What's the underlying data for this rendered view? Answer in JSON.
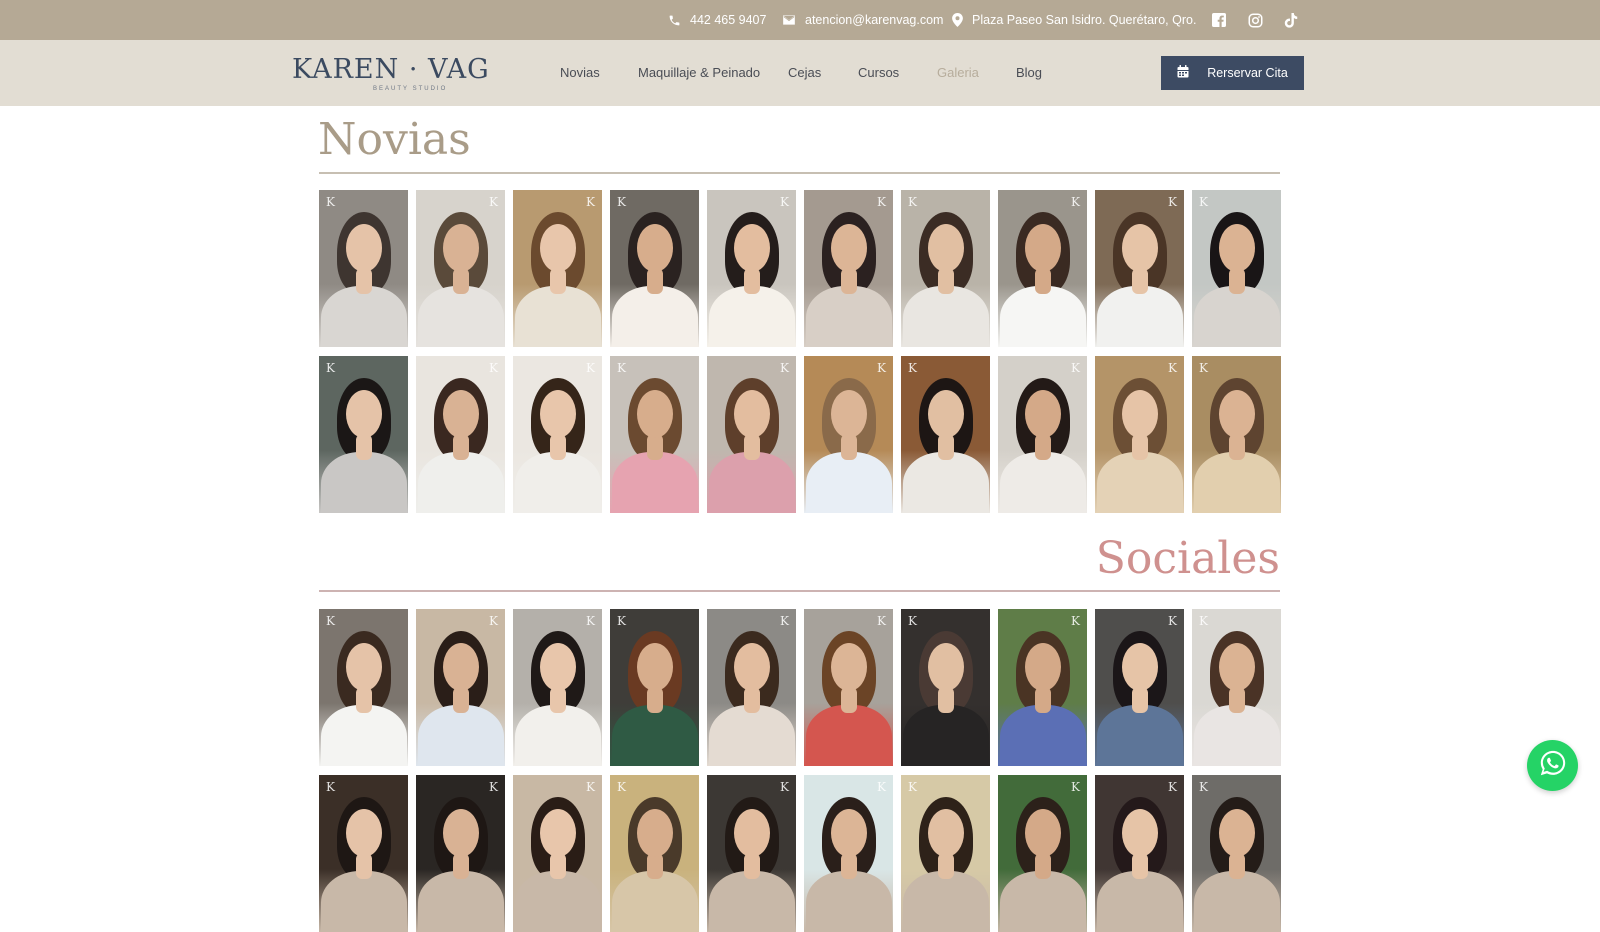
{
  "topbar": {
    "phone": "442 465 9407",
    "email": "atencion@karenvag.com",
    "address": "Plaza Paseo San Isidro. Querétaro, Qro."
  },
  "header": {
    "logo_text": "KAREN · VAG",
    "logo_subtitle": "BEAUTY STUDIO",
    "nav": [
      {
        "label": "Novias"
      },
      {
        "label": "Maquillaje & Peinado"
      },
      {
        "label": "Cejas"
      },
      {
        "label": "Cursos"
      },
      {
        "label": "Galeria"
      },
      {
        "label": "Blog"
      }
    ],
    "active_nav": "Galeria",
    "cta_label": "Rerservar Cita"
  },
  "sections": {
    "novias": {
      "title": "Novias"
    },
    "sociales": {
      "title": "Sociales"
    }
  },
  "colors": {
    "topbar_bg": "#b5a995",
    "header_bg": "#e2ddd3",
    "accent_navy": "#3d4b63",
    "novias_title": "#a99c88",
    "sociales_title": "#cf918f",
    "whatsapp": "#25d366"
  },
  "icons": [
    "phone-icon",
    "mail-icon",
    "location-pin-icon",
    "facebook-icon",
    "instagram-icon",
    "tiktok-icon",
    "calendar-icon",
    "whatsapp-icon"
  ]
}
